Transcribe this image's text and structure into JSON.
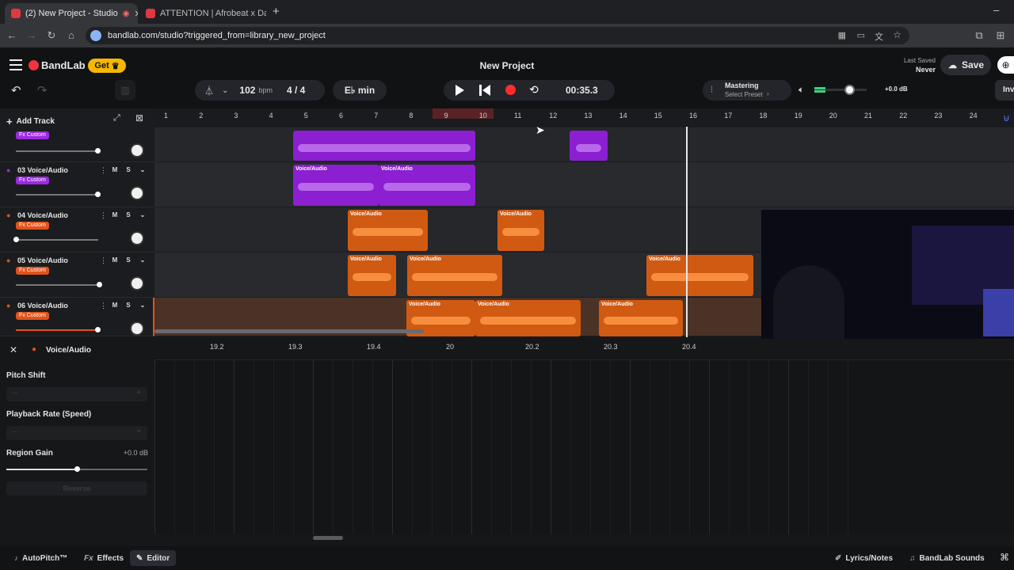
{
  "browser": {
    "tabs": [
      {
        "label": "(2) New Project - Studio",
        "active": true
      },
      {
        "label": "ATTENTION | Afrobeat x Da",
        "active": false
      }
    ],
    "new_tab": "+",
    "minimize": "–",
    "url": "bandlab.com/studio?triggered_from=library_new_project"
  },
  "app": {
    "logo": "BandLab",
    "get_label": "Get",
    "project_title": "New Project",
    "last_saved_label": "Last Saved",
    "last_saved_value": "Never",
    "save_label": "Save",
    "invite_label": "Inv"
  },
  "transport": {
    "bpm": "102",
    "bpm_unit": "bpm",
    "time_sig": "4 / 4",
    "key": "E♭ min",
    "time": "00:35.3"
  },
  "mastering": {
    "title": "Mastering",
    "subtitle": "Select Preset"
  },
  "volume": {
    "db": "+0.0 dB"
  },
  "tracklist": {
    "add_track": "Add Track",
    "tracks": [
      {
        "name": "",
        "fx": "Fx Custom",
        "color": "#8b1fd1"
      },
      {
        "name": "03 Voice/Audio",
        "fx": "Fx Custom",
        "color": "#8b1fd1"
      },
      {
        "name": "04 Voice/Audio",
        "fx": "Fx Custom",
        "color": "#d05a12"
      },
      {
        "name": "05 Voice/Audio",
        "fx": "Fx Custom",
        "color": "#d05a12"
      },
      {
        "name": "06 Voice/Audio",
        "fx": "Fx Custom",
        "color": "#d05a12"
      }
    ],
    "mute": "M",
    "solo": "S",
    "knob_l": "L",
    "knob_r": "R"
  },
  "ruler": {
    "ticks": [
      "1",
      "2",
      "3",
      "4",
      "5",
      "6",
      "7",
      "8",
      "9",
      "10",
      "11",
      "12",
      "13",
      "14",
      "15",
      "16",
      "17",
      "18",
      "19",
      "20",
      "21",
      "22",
      "23",
      "24"
    ]
  },
  "clip_label": "Voice/Audio",
  "editor": {
    "title": "Voice/Audio",
    "ruler": [
      "19.2",
      "19.3",
      "19.4",
      "20",
      "20.2",
      "20.3",
      "20.4"
    ],
    "pitch_shift": "Pitch Shift",
    "playback_rate": "Playback Rate (Speed)",
    "region_gain": "Region Gain",
    "region_gain_value": "+0.0 dB",
    "reverse": "Reverse",
    "minus": "–",
    "plus": "+"
  },
  "bottom": {
    "autopitch": "AutoPitch™",
    "effects": "Effects",
    "editor": "Editor",
    "lyrics": "Lyrics/Notes",
    "sounds": "BandLab Sounds"
  },
  "colors": {
    "accent": "#f5b800",
    "record": "#ff2d2d",
    "purple": "#8b1fd1",
    "orange": "#d05a12"
  }
}
